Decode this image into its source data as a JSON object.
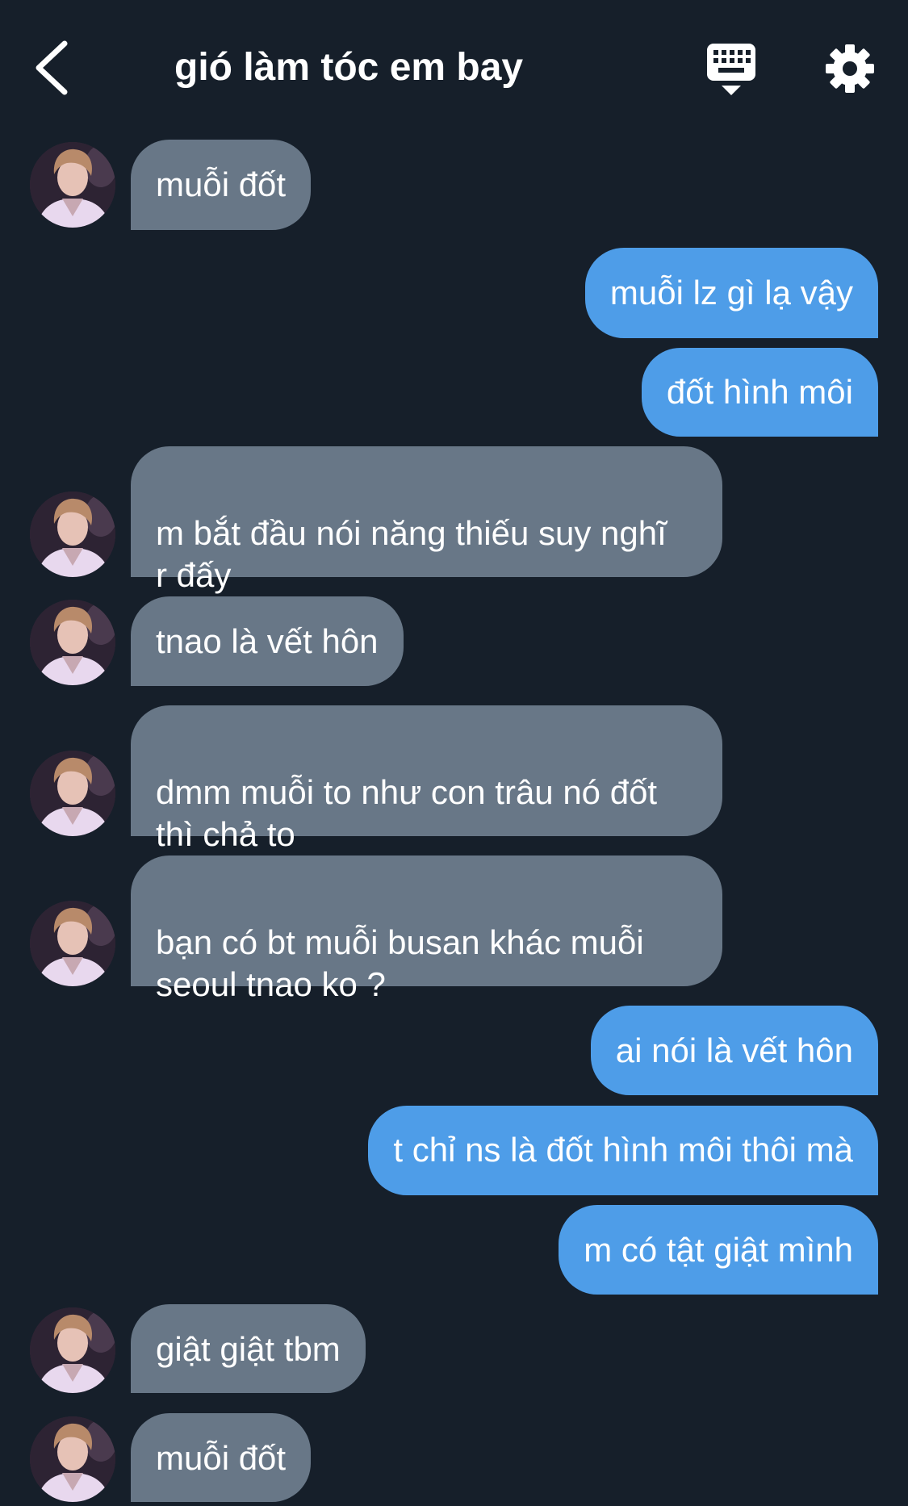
{
  "header": {
    "title": "gió làm tóc em bay",
    "back_icon": "chevron-left-icon",
    "keyboard_icon": "keyboard-icon",
    "settings_icon": "gear-icon"
  },
  "colors": {
    "background": "#161f2a",
    "incoming_bubble": "#687787",
    "outgoing_bubble": "#4e9de8",
    "text": "#ffffff"
  },
  "messages": [
    {
      "side": "in",
      "text": "muỗi đốt"
    },
    {
      "side": "out",
      "text": "muỗi lz gì lạ vậy"
    },
    {
      "side": "out",
      "text": "đốt hình môi"
    },
    {
      "side": "in",
      "text": "m bắt đầu nói năng thiếu suy nghĩ\nr đấy"
    },
    {
      "side": "in",
      "text": "tnao là vết hôn"
    },
    {
      "side": "in",
      "text": "dmm muỗi to như con trâu nó đốt\nthì chả to"
    },
    {
      "side": "in",
      "text": "bạn có bt muỗi busan khác muỗi\nseoul tnao ko ?"
    },
    {
      "side": "out",
      "text": "ai nói là vết hôn"
    },
    {
      "side": "out",
      "text": "t chỉ ns là đốt hình môi thôi mà"
    },
    {
      "side": "out",
      "text": "m có tật giật mình"
    },
    {
      "side": "in",
      "text": "giật giật tbm"
    },
    {
      "side": "in",
      "text": "muỗi đốt"
    }
  ]
}
